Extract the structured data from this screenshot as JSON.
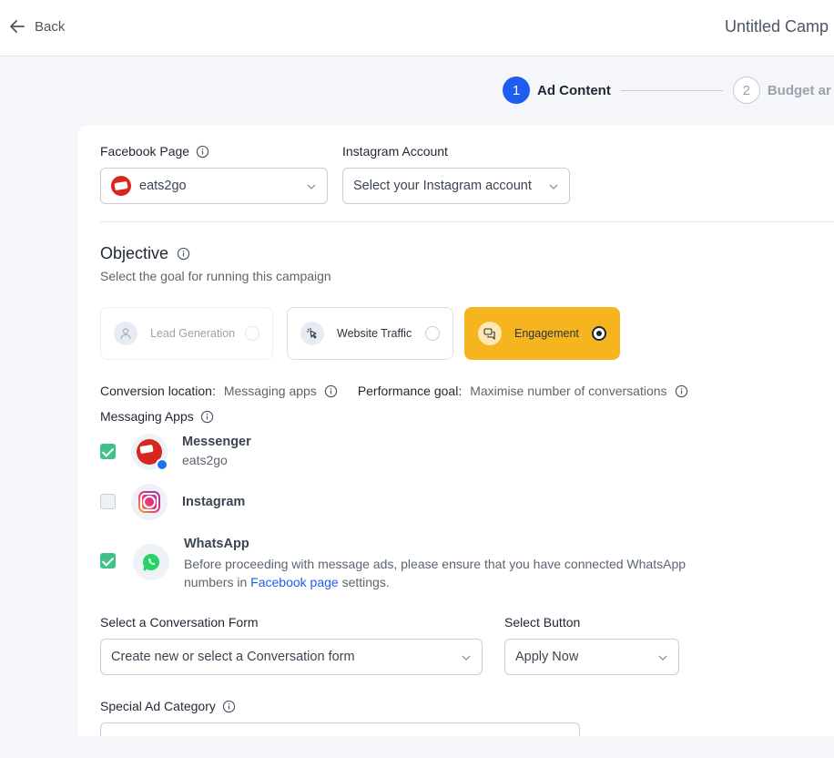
{
  "header": {
    "back_label": "Back",
    "campaign_title": "Untitled Camp"
  },
  "stepper": [
    {
      "number": "1",
      "label": "Ad Content"
    },
    {
      "number": "2",
      "label": "Budget ar"
    }
  ],
  "facebook_page": {
    "label": "Facebook Page",
    "value": "eats2go"
  },
  "instagram_account": {
    "label": "Instagram Account",
    "placeholder": "Select your Instagram account"
  },
  "objective": {
    "title": "Objective",
    "subtitle": "Select the goal for running this campaign",
    "options": [
      {
        "label": "Lead Generation"
      },
      {
        "label": "Website Traffic"
      },
      {
        "label": "Engagement"
      }
    ]
  },
  "conversion": {
    "location_label": "Conversion location:",
    "location_value": "Messaging apps",
    "goal_label": "Performance goal:",
    "goal_value": "Maximise number of conversations"
  },
  "messaging_apps": {
    "label": "Messaging Apps",
    "messenger": {
      "name": "Messenger",
      "sub": "eats2go"
    },
    "instagram": {
      "name": "Instagram"
    },
    "whatsapp": {
      "name": "WhatsApp",
      "note_before": "Before proceeding with message ads, please ensure that you have connected WhatsApp numbers in ",
      "note_link": "Facebook page",
      "note_after": " settings."
    }
  },
  "conversation_form": {
    "label": "Select a Conversation Form",
    "placeholder": "Create new or select a Conversation form"
  },
  "select_button": {
    "label": "Select Button",
    "value": "Apply Now"
  },
  "special_ad_category": {
    "label": "Special Ad Category"
  }
}
